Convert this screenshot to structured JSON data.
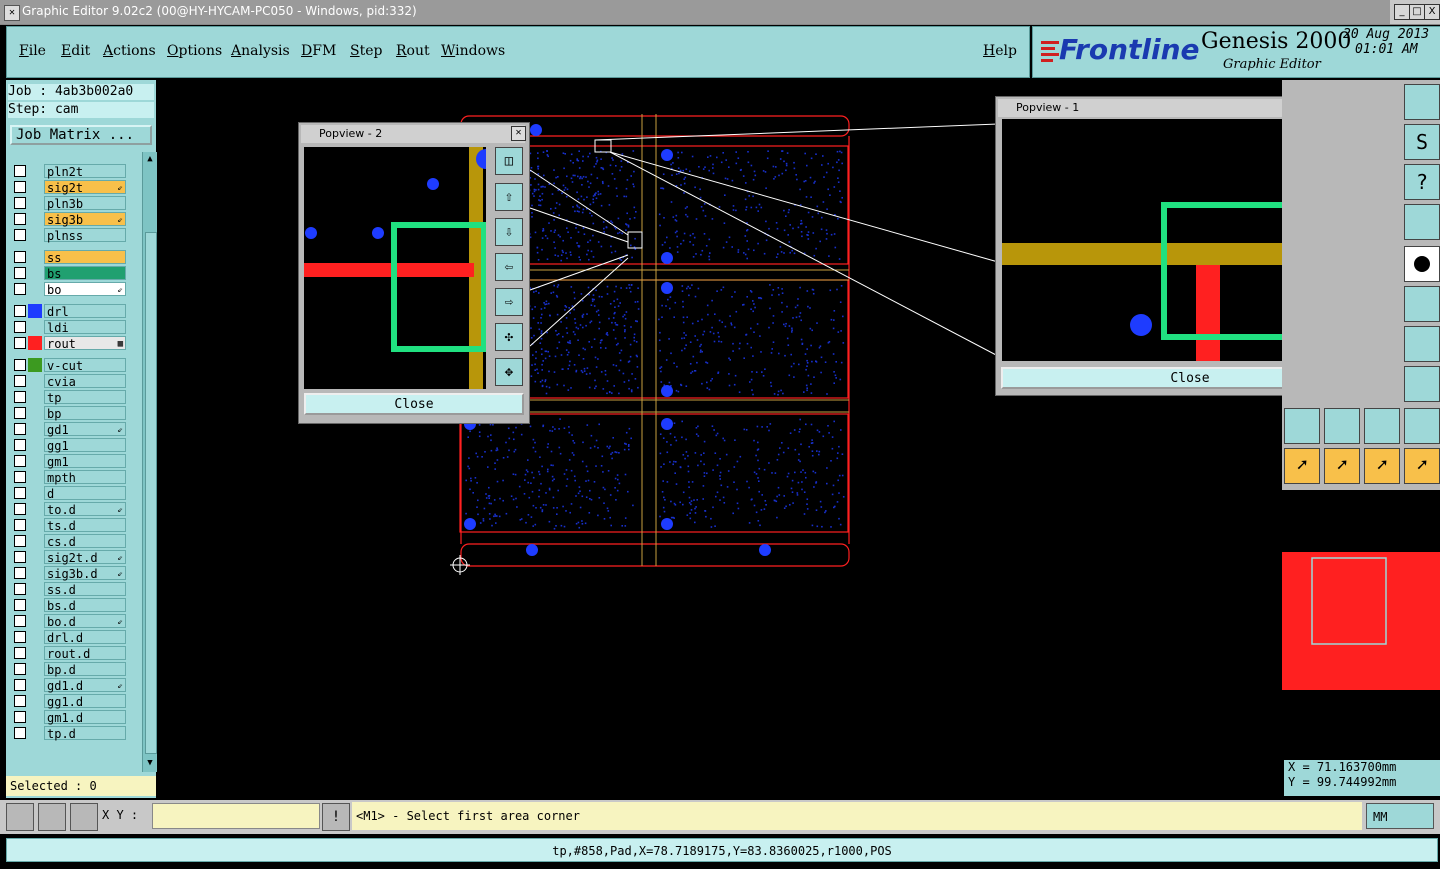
{
  "window": {
    "title": "Graphic Editor 9.02c2 (00@HY-HYCAM-PC050 - Windows, pid:332)",
    "min_label": "_",
    "max_label": "□",
    "close_label": "X"
  },
  "menu": [
    "File",
    "Edit",
    "Actions",
    "Options",
    "Analysis",
    "DFM",
    "Step",
    "Rout",
    "Windows"
  ],
  "help": "Help",
  "logo": {
    "brand": "Frontline",
    "product": "Genesis 2000",
    "subtitle": "Graphic Editor",
    "date": "20 Aug 2013",
    "time": "01:01 AM"
  },
  "job": {
    "line1": "Job : 4ab3b002a0",
    "line2": "Step: cam",
    "matrix_label": "Job Matrix ..."
  },
  "layers": [
    {
      "name": "pln2t",
      "color": "#9ed8d8",
      "mark": ""
    },
    {
      "name": "sig2t",
      "color": "#f8c04a",
      "mark": "⇙"
    },
    {
      "name": "pln3b",
      "color": "#9ed8d8",
      "mark": ""
    },
    {
      "name": "sig3b",
      "color": "#f8c04a",
      "mark": "⇙"
    },
    {
      "name": "plnss",
      "color": "#9ed8d8",
      "mark": ""
    },
    {
      "name": "ss",
      "color": "#f8c04a",
      "mark": ""
    },
    {
      "name": "bs",
      "color": "#20a070",
      "mark": ""
    },
    {
      "name": "bo",
      "color": "#ffffff",
      "mark": "⇙"
    },
    {
      "name": "drl",
      "color": "#9ed8d8",
      "mark": "",
      "swatch": "#1e3cff"
    },
    {
      "name": "ldi",
      "color": "#9ed8d8",
      "mark": ""
    },
    {
      "name": "rout",
      "color": "#e8e8e8",
      "mark": "▦",
      "swatch": "#ff2020"
    },
    {
      "name": "v-cut",
      "color": "#9ed8d8",
      "mark": "",
      "swatch": "#3c9a20"
    },
    {
      "name": "cvia",
      "color": "#9ed8d8",
      "mark": ""
    },
    {
      "name": "tp",
      "color": "#9ed8d8",
      "mark": ""
    },
    {
      "name": "bp",
      "color": "#9ed8d8",
      "mark": ""
    },
    {
      "name": "gd1",
      "color": "#9ed8d8",
      "mark": "⇙"
    },
    {
      "name": "gg1",
      "color": "#9ed8d8",
      "mark": ""
    },
    {
      "name": "gm1",
      "color": "#9ed8d8",
      "mark": ""
    },
    {
      "name": "mpth",
      "color": "#9ed8d8",
      "mark": ""
    },
    {
      "name": "d",
      "color": "#9ed8d8",
      "mark": ""
    },
    {
      "name": "to.d",
      "color": "#9ed8d8",
      "mark": "⇙"
    },
    {
      "name": "ts.d",
      "color": "#9ed8d8",
      "mark": ""
    },
    {
      "name": "cs.d",
      "color": "#9ed8d8",
      "mark": ""
    },
    {
      "name": "sig2t.d",
      "color": "#9ed8d8",
      "mark": "⇙"
    },
    {
      "name": "sig3b.d",
      "color": "#9ed8d8",
      "mark": "⇙"
    },
    {
      "name": "ss.d",
      "color": "#9ed8d8",
      "mark": ""
    },
    {
      "name": "bs.d",
      "color": "#9ed8d8",
      "mark": ""
    },
    {
      "name": "bo.d",
      "color": "#9ed8d8",
      "mark": "⇙"
    },
    {
      "name": "drl.d",
      "color": "#9ed8d8",
      "mark": ""
    },
    {
      "name": "rout.d",
      "color": "#9ed8d8",
      "mark": ""
    },
    {
      "name": "bp.d",
      "color": "#9ed8d8",
      "mark": ""
    },
    {
      "name": "gd1.d",
      "color": "#9ed8d8",
      "mark": "⇙"
    },
    {
      "name": "gg1.d",
      "color": "#9ed8d8",
      "mark": ""
    },
    {
      "name": "gm1.d",
      "color": "#9ed8d8",
      "mark": ""
    },
    {
      "name": "tp.d",
      "color": "#9ed8d8",
      "mark": ""
    }
  ],
  "selected": "Selected : 0",
  "xy_label": "X Y :",
  "prompt": "<M1> - Select first area corner",
  "units": "MM",
  "status": "tp,#858,Pad,X=78.7189175,Y=83.8360025,r1000,POS",
  "popview1": {
    "title": "Popview - 1",
    "close": "Close"
  },
  "popview2": {
    "title": "Popview - 2",
    "close": "Close"
  },
  "coords": {
    "x": "X = 71.163700mm",
    "y": "Y = 99.744992mm"
  },
  "colors": {
    "accent": "#9ed8d8",
    "board_outline": "#ff2020",
    "pad": "#1e3cff",
    "trace": "#b8960a",
    "highlight": "#20e080"
  }
}
